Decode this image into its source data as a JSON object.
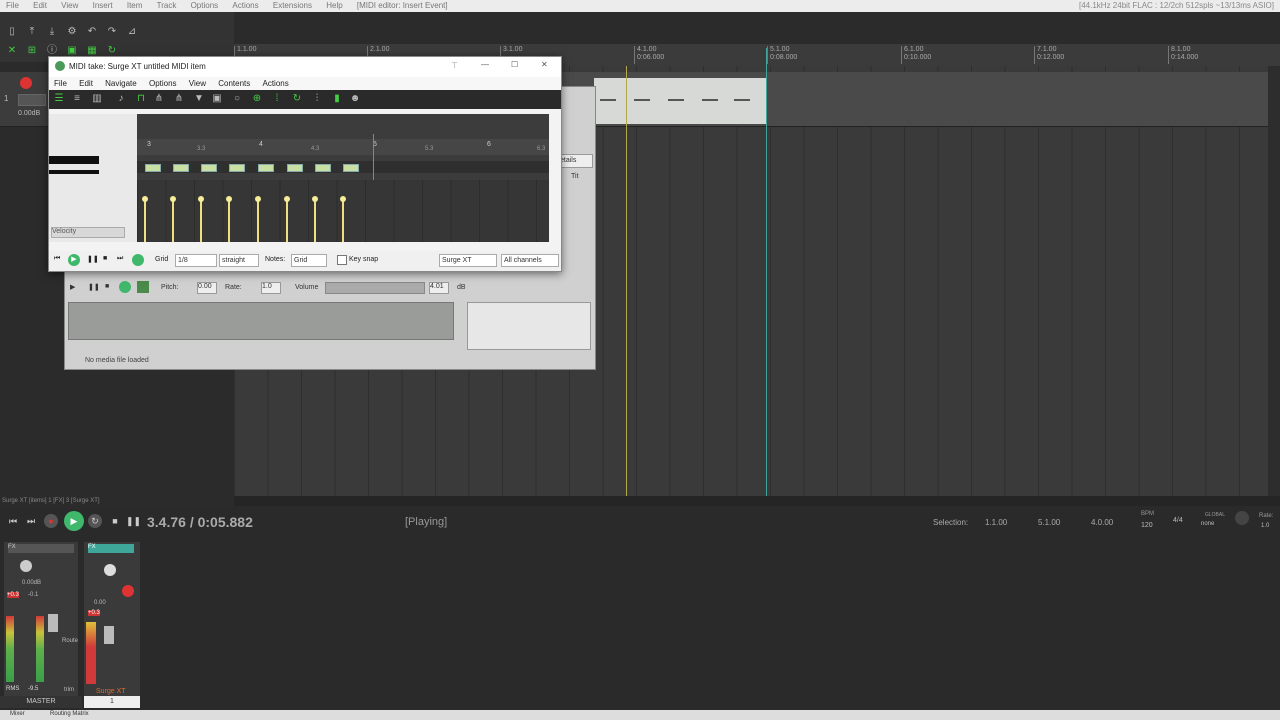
{
  "menubar": {
    "items": [
      "File",
      "Edit",
      "View",
      "Insert",
      "Item",
      "Track",
      "Options",
      "Actions",
      "Extensions",
      "Help"
    ],
    "context": "[MIDI editor: Insert Event]",
    "status": "[44.1kHz 24bit FLAC : 12/2ch 512spls ~13/13ms ASIO]"
  },
  "ruler": {
    "marks": [
      {
        "label": "1.1.00",
        "sub": ""
      },
      {
        "label": "2.1.00",
        "sub": ""
      },
      {
        "label": "3.1.00",
        "sub": ""
      },
      {
        "label": "4.1.00",
        "sub": "0:06.000"
      },
      {
        "label": "5.1.00",
        "sub": "0:08.000"
      },
      {
        "label": "6.1.00",
        "sub": "0:10.000"
      },
      {
        "label": "7.1.00",
        "sub": "0:12.000"
      },
      {
        "label": "8.1.00",
        "sub": "0:14.000"
      }
    ]
  },
  "track": {
    "number": "1",
    "volume": "0.00dB"
  },
  "midi_editor": {
    "title": "MIDI take: Surge XT untitled MIDI item",
    "menu": [
      "File",
      "Edit",
      "Navigate",
      "Options",
      "View",
      "Contents",
      "Actions"
    ],
    "ruler_labels": [
      "3",
      "3.3",
      "4",
      "4.3",
      "5",
      "5.3",
      "6",
      "6.3"
    ],
    "velocity_label": "Velocity",
    "grid_label": "Grid",
    "grid_value": "1/8",
    "swing_value": "straight",
    "notes_label": "Notes:",
    "notes_value": "Grid",
    "key_snap_label": "Key snap",
    "instrument": "Surge XT",
    "channels": "All channels"
  },
  "media_explorer": {
    "details": "etails",
    "col_title": "Tit",
    "pitch_label": "Pitch:",
    "pitch_value": "0.00",
    "rate_label": "Rate:",
    "rate_value": "1.0",
    "volume_label": "Volume",
    "volume_value": "4.01",
    "volume_unit": "dB",
    "status": "No media file loaded"
  },
  "transport": {
    "timecode": "3.4.76 / 0:05.882",
    "state": "[Playing]",
    "selection_label": "Selection:",
    "sel_start": "1.1.00",
    "sel_end": "5.1.00",
    "sel_len": "4.0.00",
    "bpm_label": "BPM",
    "bpm": "120",
    "timesig": "4/4",
    "global_label": "GLOBAL",
    "global_value": "none",
    "rate_label": "Rate:",
    "rate_value": "1.0"
  },
  "track_info": "Surge XT [items] 1 [FX] 3 [Surge XT]",
  "mixer": {
    "master_fx": "FX",
    "master_vol": "0.00dB",
    "master_peak_l": "+0.3",
    "master_peak_r": "-0.1",
    "rms_label": "RMS",
    "rms_value": "-9.5",
    "route": "Route",
    "trim": "trim",
    "master_label": "MASTER",
    "track_fx": "FX",
    "track_vol": "0.00",
    "track_peak": "+0.3",
    "track_name": "Surge XT",
    "track_number": "1"
  },
  "bottom_tabs": [
    "Mixer",
    "Routing Matrix"
  ],
  "colors": {
    "accent_green": "#3fa79a",
    "play_green": "#3fb86b",
    "record_red": "#d33"
  }
}
